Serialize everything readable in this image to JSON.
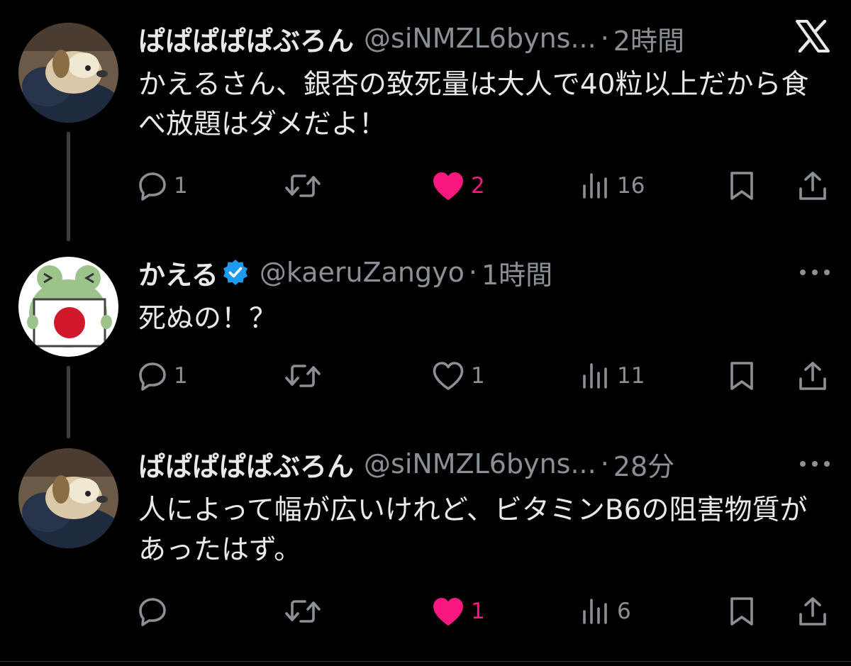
{
  "tweets": [
    {
      "display_name": "ぱぱぱぱぱぶろん",
      "handle": "@siNMZL6byns...",
      "separator": "·",
      "time": "2時間",
      "text": "かえるさん、銀杏の致死量は大人で40粒以上だから食べ放題はダメだよ！",
      "replies": "1",
      "retweets": "",
      "likes": "2",
      "liked": true,
      "views": "16",
      "corner": "x-logo-icon"
    },
    {
      "display_name": "かえる",
      "handle": "@kaeruZangyo",
      "separator": "·",
      "time": "1時間",
      "text": "死ぬの！？",
      "replies": "1",
      "retweets": "",
      "likes": "1",
      "liked": false,
      "views": "11",
      "verified": true,
      "corner": "more-icon"
    },
    {
      "display_name": "ぱぱぱぱぱぶろん",
      "handle": "@siNMZL6byns...",
      "separator": "·",
      "time": "28分",
      "text": "人によって幅が広いけれど、ビタミンB6の阻害物質があったはず。",
      "replies": "",
      "retweets": "",
      "likes": "1",
      "liked": true,
      "views": "6",
      "corner": "more-icon"
    }
  ],
  "colors": {
    "background": "#000000",
    "primary_text": "#e7e9ea",
    "secondary_text": "#8b9096",
    "like": "#f91880",
    "verified": "#1d9bf0",
    "thread_line": "#3a3d41"
  }
}
